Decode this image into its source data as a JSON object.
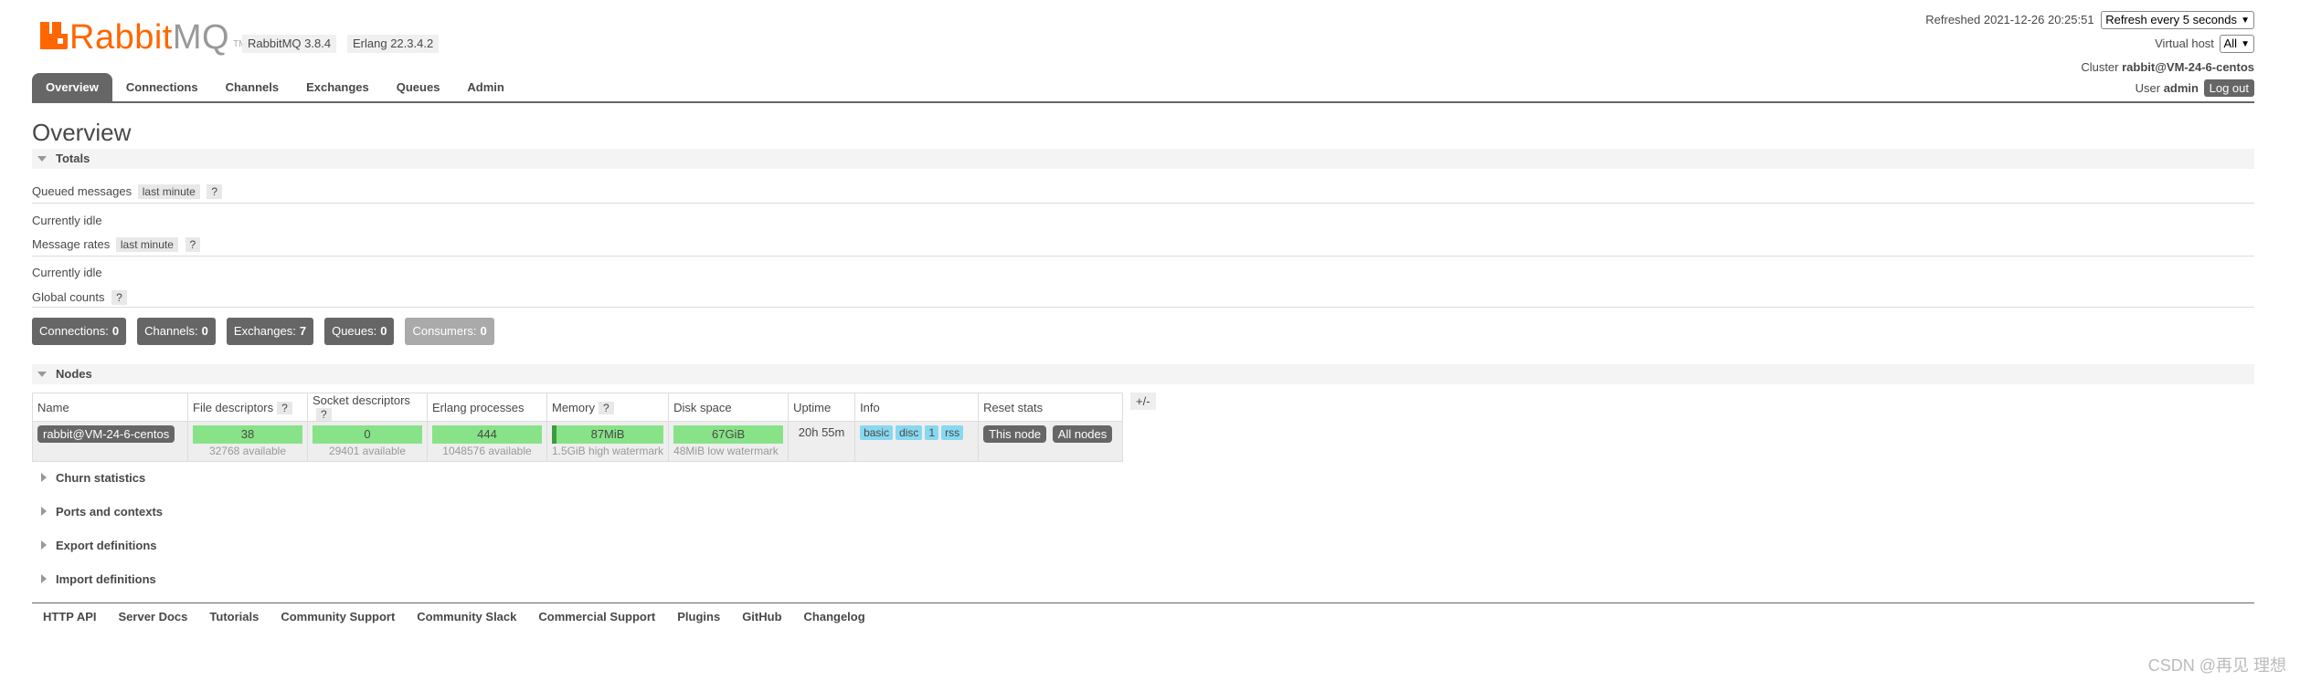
{
  "header": {
    "logo_rabbit": "Rabbit",
    "logo_mq": "MQ",
    "logo_tm": "TM",
    "versions": [
      "RabbitMQ 3.8.4",
      "Erlang 22.3.4.2"
    ],
    "refreshed_label": "Refreshed 2021-12-26 20:25:51",
    "refresh_select": "Refresh every 5 seconds",
    "vhost_label": "Virtual host",
    "vhost_select": "All",
    "cluster_label": "Cluster",
    "cluster_name": "rabbit@VM-24-6-centos",
    "user_label": "User",
    "user_name": "admin",
    "logout": "Log out"
  },
  "tabs": [
    "Overview",
    "Connections",
    "Channels",
    "Exchanges",
    "Queues",
    "Admin"
  ],
  "page_title": "Overview",
  "totals": {
    "title": "Totals",
    "queued_label": "Queued messages",
    "queued_chip": "last minute",
    "help": "?",
    "idle1": "Currently idle",
    "rates_label": "Message rates",
    "rates_chip": "last minute",
    "idle2": "Currently idle",
    "global_label": "Global counts"
  },
  "counts": [
    {
      "label": "Connections:",
      "value": "0"
    },
    {
      "label": "Channels:",
      "value": "0"
    },
    {
      "label": "Exchanges:",
      "value": "7"
    },
    {
      "label": "Queues:",
      "value": "0"
    },
    {
      "label": "Consumers:",
      "value": "0"
    }
  ],
  "nodes": {
    "title": "Nodes",
    "headers": [
      "Name",
      "File descriptors",
      "Socket descriptors",
      "Erlang processes",
      "Memory",
      "Disk space",
      "Uptime",
      "Info",
      "Reset stats"
    ],
    "plusminus": "+/-",
    "row": {
      "name": "rabbit@VM-24-6-centos",
      "fd": "38",
      "fd_sub": "32768 available",
      "sd": "0",
      "sd_sub": "29401 available",
      "ep": "444",
      "ep_sub": "1048576 available",
      "mem": "87MiB",
      "mem_sub": "1.5GiB high watermark",
      "disk": "67GiB",
      "disk_sub": "48MiB low watermark",
      "uptime": "20h 55m",
      "info_tags": [
        "basic",
        "disc",
        "1",
        "rss"
      ],
      "reset_this": "This node",
      "reset_all": "All nodes"
    }
  },
  "collapsed_sections": [
    "Churn statistics",
    "Ports and contexts",
    "Export definitions",
    "Import definitions"
  ],
  "footer_links": [
    "HTTP API",
    "Server Docs",
    "Tutorials",
    "Community Support",
    "Community Slack",
    "Commercial Support",
    "Plugins",
    "GitHub",
    "Changelog"
  ],
  "watermark": "CSDN @再见 理想",
  "colors": {
    "brand": "#ff6600",
    "bar_green": "#88e388",
    "tag_blue": "#88d8f0",
    "dark": "#666666"
  }
}
